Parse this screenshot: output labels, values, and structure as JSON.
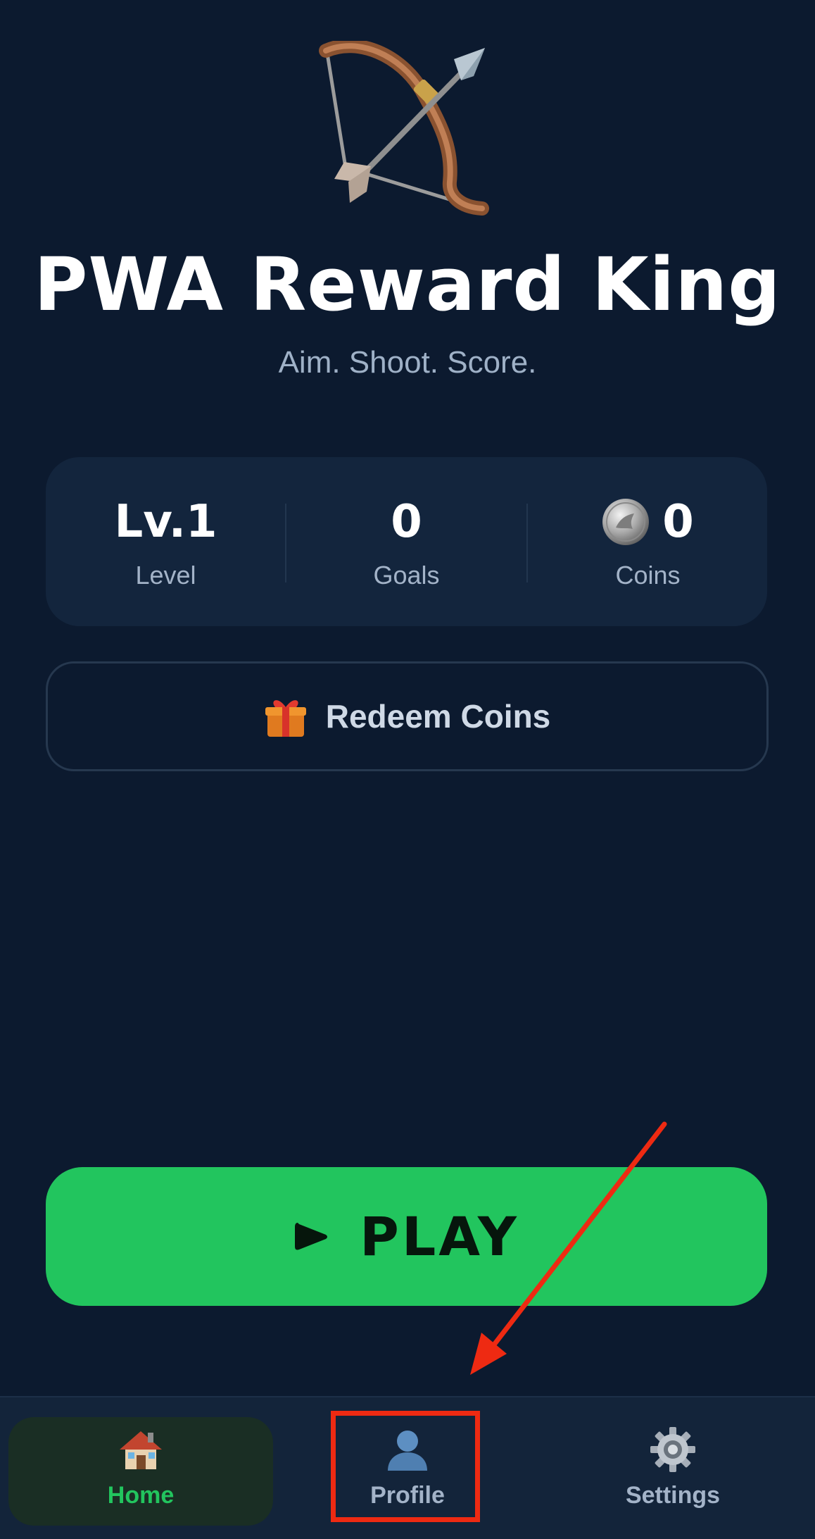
{
  "app": {
    "title": "PWA Reward King",
    "subtitle": "Aim. Shoot. Score.",
    "hero_icon": "bow-and-arrow-icon"
  },
  "stats": {
    "level": {
      "value": "Lv.1",
      "label": "Level"
    },
    "goals": {
      "value": "0",
      "label": "Goals"
    },
    "coins": {
      "value": "0",
      "label": "Coins",
      "icon": "coin-icon"
    }
  },
  "redeem": {
    "label": "Redeem Coins",
    "icon": "gift-icon"
  },
  "play": {
    "label": "PLAY",
    "icon": "play-icon"
  },
  "nav": {
    "items": [
      {
        "label": "Home",
        "icon": "house-icon",
        "active": true
      },
      {
        "label": "Profile",
        "icon": "user-icon",
        "active": false
      },
      {
        "label": "Settings",
        "icon": "gear-icon",
        "active": false
      }
    ]
  },
  "colors": {
    "background": "#0c1a2f",
    "card": "#13253d",
    "accent_green": "#22c55e",
    "annotation_red": "#ee2a12"
  }
}
